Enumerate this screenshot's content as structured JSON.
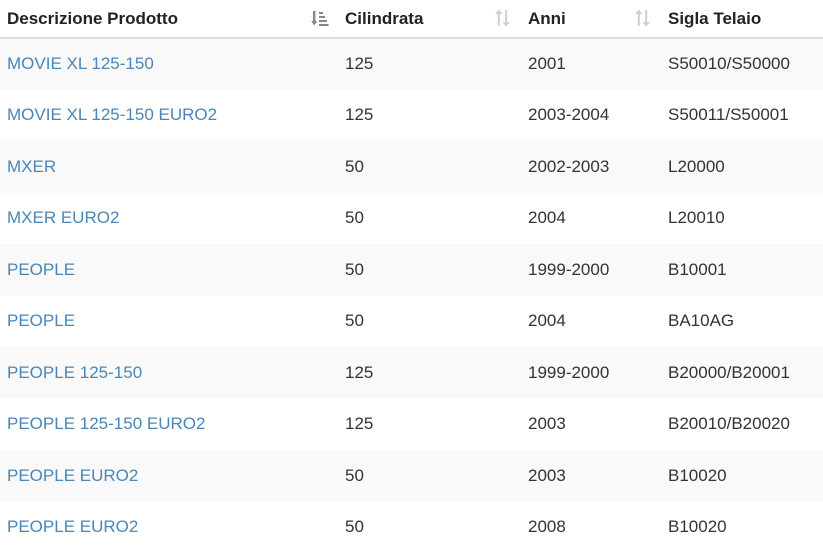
{
  "table": {
    "columns": [
      {
        "label": "Descrizione Prodotto",
        "sort_state": "ascending"
      },
      {
        "label": "Cilindrata",
        "sort_state": "unsorted"
      },
      {
        "label": "Anni",
        "sort_state": "unsorted"
      },
      {
        "label": "Sigla Telaio",
        "sort_state": "none"
      }
    ],
    "rows": [
      {
        "product": "MOVIE XL 125-150",
        "cc": "125",
        "years": "2001",
        "frame": "S50010/S50000"
      },
      {
        "product": "MOVIE XL 125-150 EURO2",
        "cc": "125",
        "years": "2003-2004",
        "frame": "S50011/S50001"
      },
      {
        "product": "MXER",
        "cc": "50",
        "years": "2002-2003",
        "frame": "L20000"
      },
      {
        "product": "MXER EURO2",
        "cc": "50",
        "years": "2004",
        "frame": "L20010"
      },
      {
        "product": "PEOPLE",
        "cc": "50",
        "years": "1999-2000",
        "frame": "B10001"
      },
      {
        "product": "PEOPLE",
        "cc": "50",
        "years": "2004",
        "frame": "BA10AG"
      },
      {
        "product": "PEOPLE 125-150",
        "cc": "125",
        "years": "1999-2000",
        "frame": "B20000/B20001"
      },
      {
        "product": "PEOPLE 125-150 EURO2",
        "cc": "125",
        "years": "2003",
        "frame": "B20010/B20020"
      },
      {
        "product": "PEOPLE EURO2",
        "cc": "50",
        "years": "2003",
        "frame": "B10020"
      },
      {
        "product": "PEOPLE EURO2",
        "cc": "50",
        "years": "2008",
        "frame": "B10020"
      }
    ]
  },
  "colors": {
    "link": "#4a86b7",
    "stripe": "#f9f9f9",
    "sort_active": "#888888",
    "sort_inactive": "#cfcfcf"
  }
}
